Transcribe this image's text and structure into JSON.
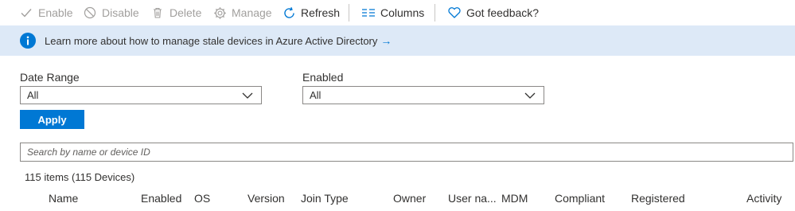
{
  "toolbar": {
    "enable_label": "Enable",
    "disable_label": "Disable",
    "delete_label": "Delete",
    "manage_label": "Manage",
    "refresh_label": "Refresh",
    "columns_label": "Columns",
    "feedback_label": "Got feedback?"
  },
  "banner": {
    "text": "Learn more about how to manage stale devices in Azure Active Directory",
    "arrow": "→",
    "icon": "info-icon"
  },
  "filters": {
    "date_range_label": "Date Range",
    "date_range_value": "All",
    "enabled_label": "Enabled",
    "enabled_value": "All",
    "apply_label": "Apply"
  },
  "search": {
    "placeholder": "Search by name or device ID"
  },
  "summary": {
    "count_text": "115 items (115 Devices)"
  },
  "table": {
    "columns": [
      "Name",
      "Enabled",
      "OS",
      "Version",
      "Join Type",
      "Owner",
      "User na...",
      "MDM",
      "Compliant",
      "Registered",
      "Activity"
    ]
  },
  "colors": {
    "accent": "#0078d4",
    "banner_bg": "#dde9f7",
    "disabled_text": "#a19f9d"
  }
}
